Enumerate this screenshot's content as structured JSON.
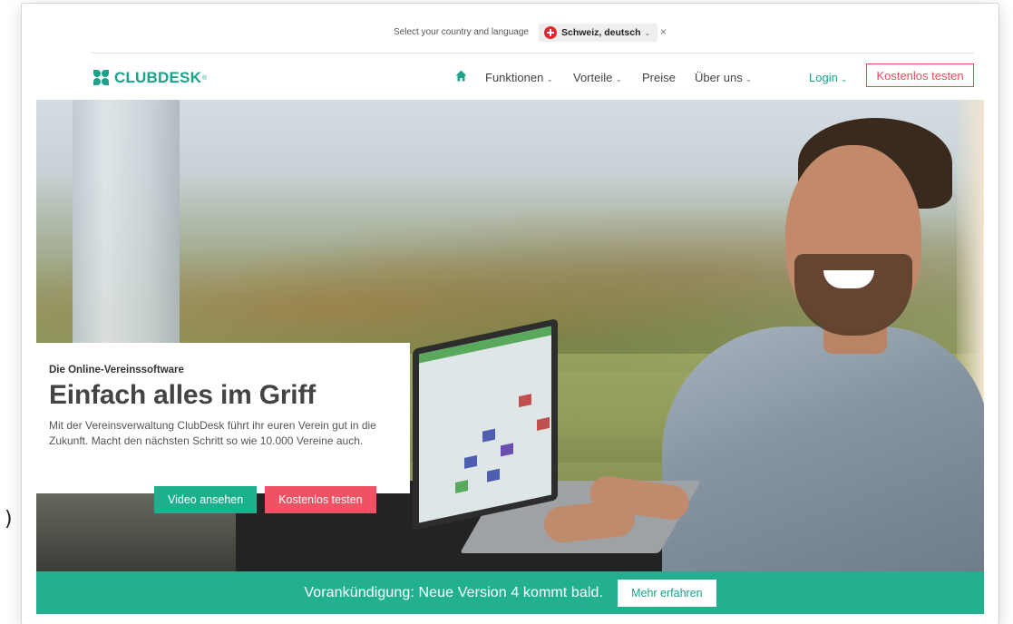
{
  "lang_bar": {
    "label": "Select your country and language",
    "selected": "Schweiz, deutsch",
    "close_glyph": "×"
  },
  "nav": {
    "logo": "CLUBDESK",
    "logo_reg": "®",
    "items": [
      {
        "label": "Funktionen",
        "has_dropdown": true
      },
      {
        "label": "Vorteile",
        "has_dropdown": true
      },
      {
        "label": "Preise",
        "has_dropdown": false
      },
      {
        "label": "Über uns",
        "has_dropdown": true
      }
    ],
    "login": "Login",
    "cta": "Kostenlos testen",
    "dropdown_glyph": "⌄"
  },
  "hero": {
    "eyebrow": "Die Online-Vereinssoftware",
    "title": "Einfach alles im Griff",
    "text": "Mit der Vereinsverwaltung ClubDesk führt ihr euren Verein gut in die Zukunft. Macht den nächsten Schritt so wie 10.000 Vereine auch.",
    "btn_video": "Video ansehen",
    "btn_trial": "Kostenlos testen"
  },
  "announcement": {
    "text": "Vorankündigung: Neue Version 4 kommt bald.",
    "button": "Mehr erfahren"
  },
  "colors": {
    "brand_green": "#1aa38a",
    "cta_red": "#e8495a",
    "announce_bg": "#22b08f"
  },
  "icons": {
    "home": "home-icon",
    "flag": "swiss-flag-icon",
    "close": "close-icon",
    "chevron": "chevron-down-icon"
  },
  "edge_glyph": ")"
}
